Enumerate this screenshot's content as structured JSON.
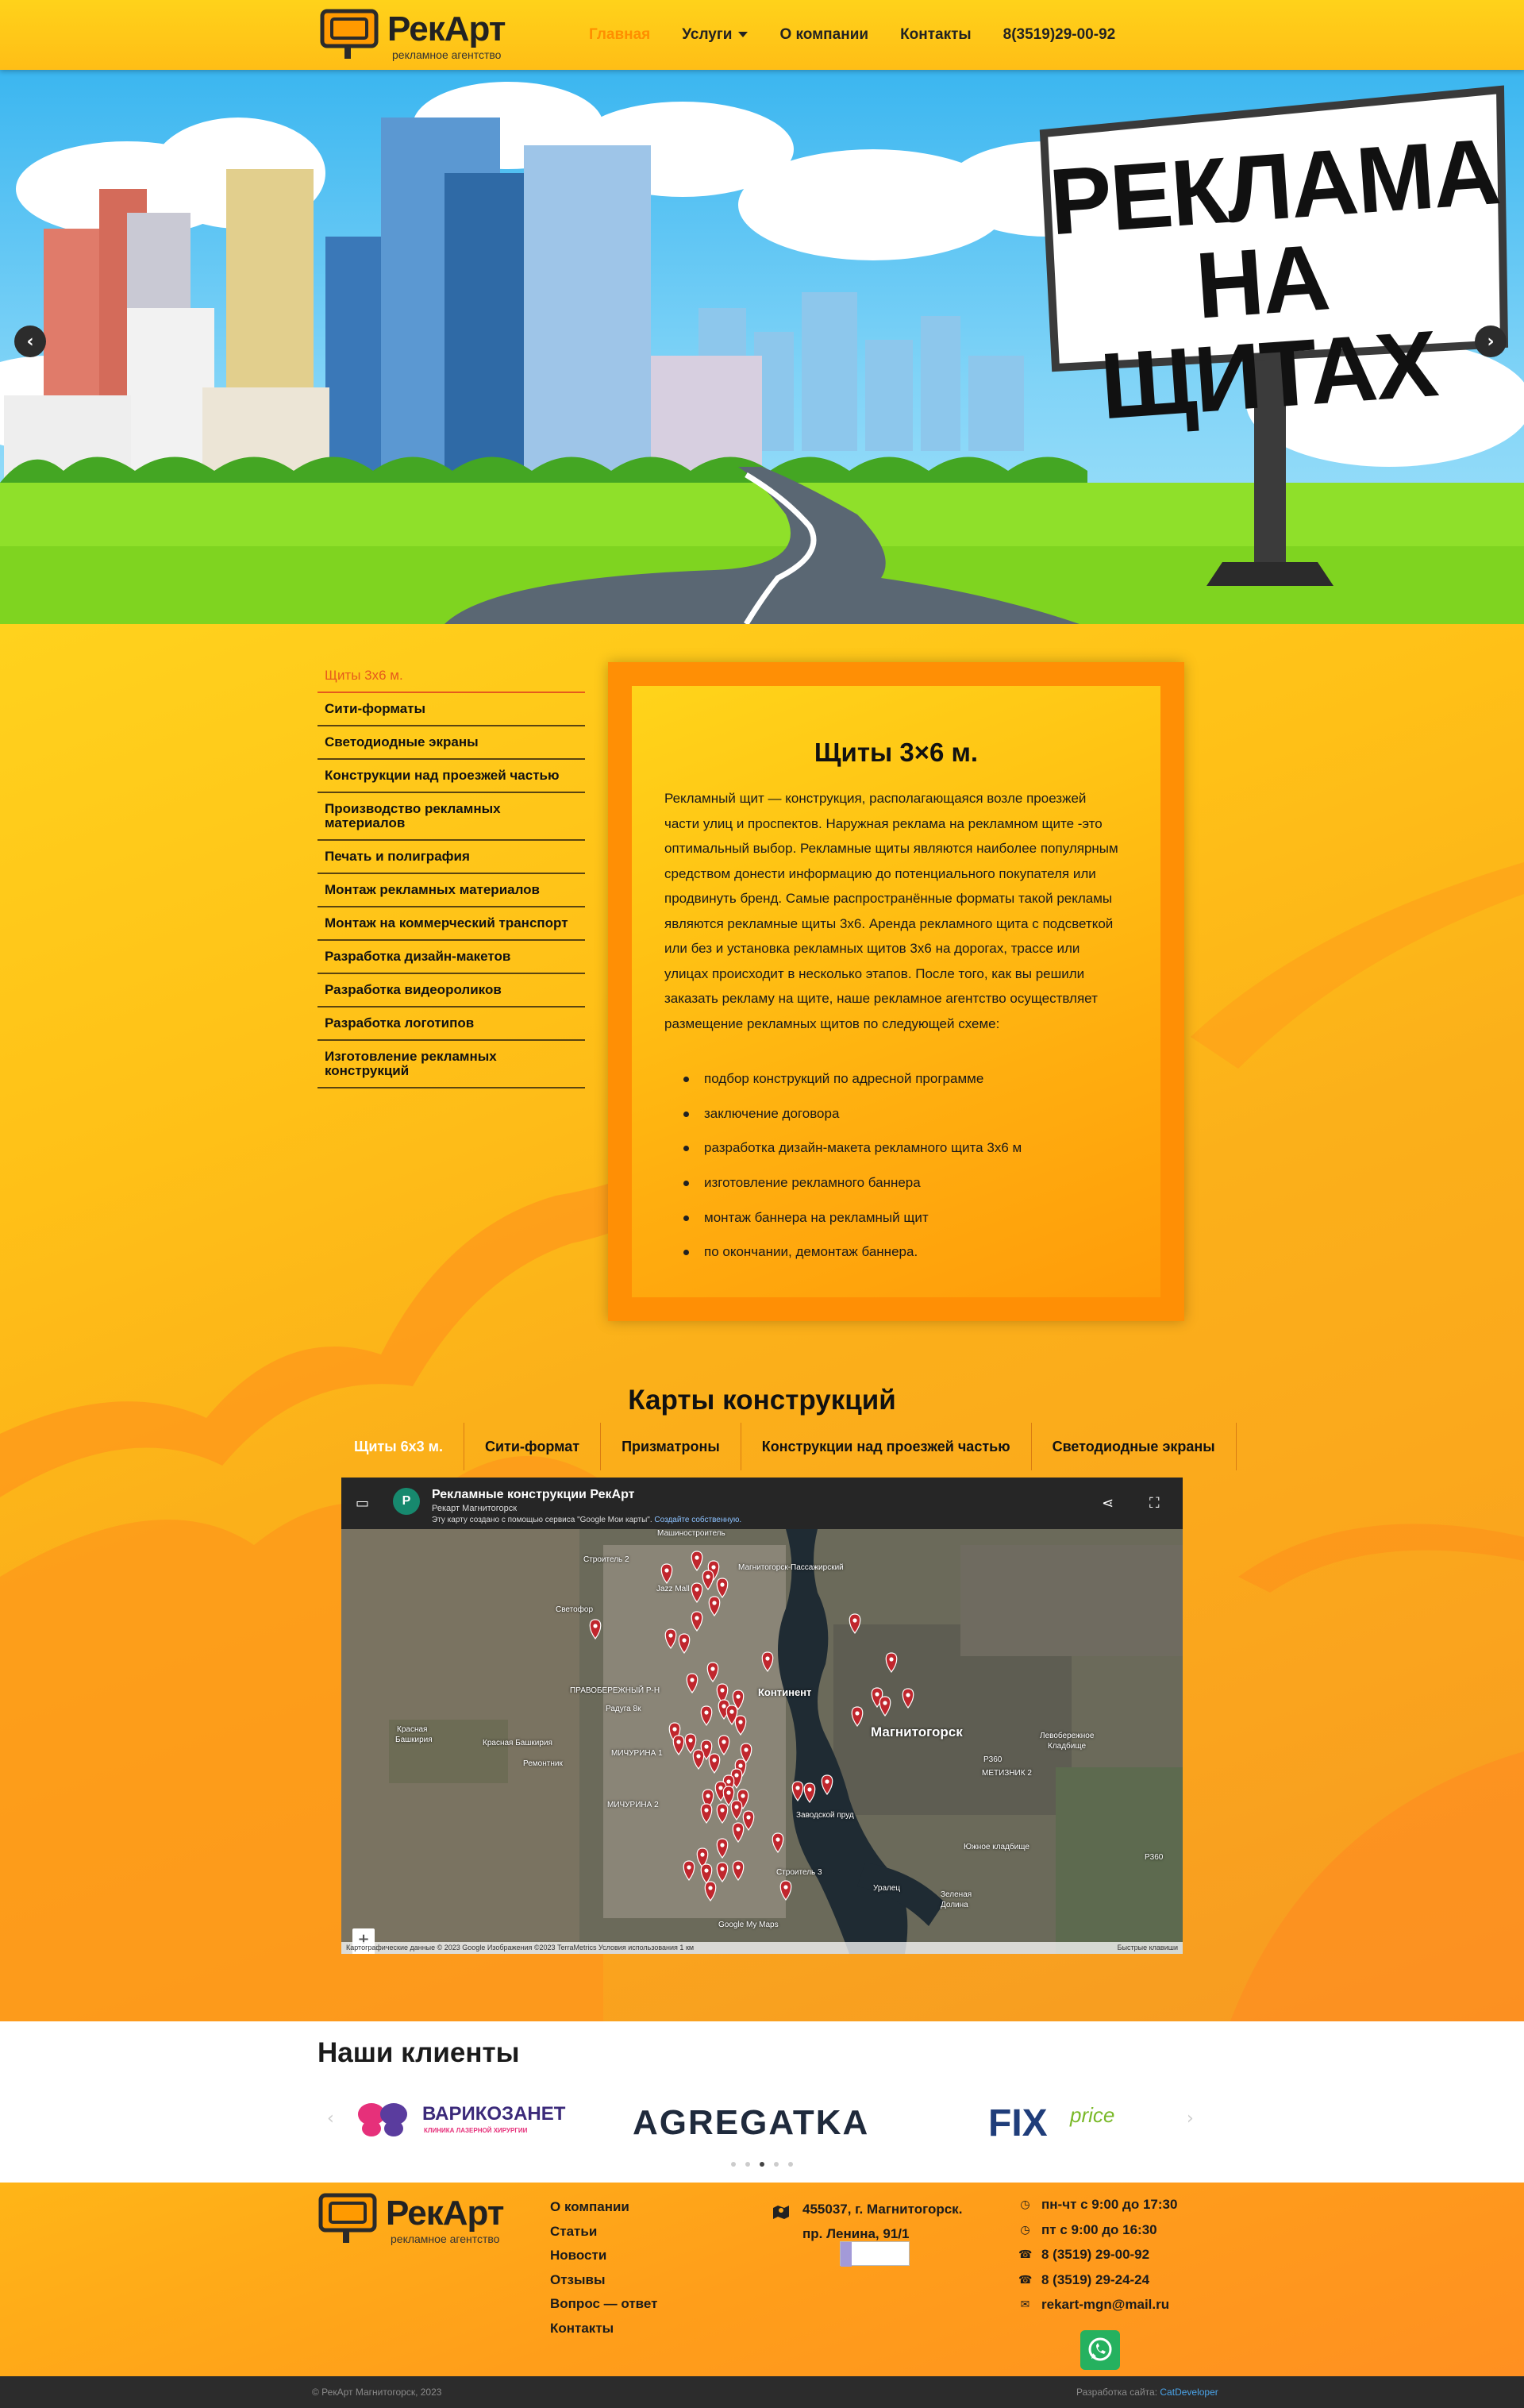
{
  "header": {
    "logo_name": "РекАрт",
    "logo_sub": "рекламное агентство",
    "nav": [
      {
        "label": "Главная",
        "active": true
      },
      {
        "label": "Услуги",
        "dropdown": true
      },
      {
        "label": "О компании"
      },
      {
        "label": "Контакты"
      },
      {
        "label": "8(3519)29-00-92"
      }
    ]
  },
  "hero": {
    "billboard_line1": "РЕКЛАМА",
    "billboard_line2": "НА ЩИТАХ",
    "prev_icon": "chevron-left-icon",
    "next_icon": "chevron-right-icon"
  },
  "sidebar": {
    "items": [
      {
        "label": "Щиты 3х6 м.",
        "active": true
      },
      {
        "label": "Сити-форматы"
      },
      {
        "label": "Светодиодные экраны"
      },
      {
        "label": "Конструкции над проезжей частью"
      },
      {
        "label": "Производство рекламных материалов"
      },
      {
        "label": "Печать и полиграфия"
      },
      {
        "label": "Монтаж рекламных материалов"
      },
      {
        "label": "Монтаж на коммерческий транспорт"
      },
      {
        "label": "Разработка дизайн-макетов"
      },
      {
        "label": "Разработка видеороликов"
      },
      {
        "label": "Разработка логотипов"
      },
      {
        "label": "Изготовление рекламных конструкций"
      }
    ]
  },
  "content": {
    "title": "Щиты 3×6 м.",
    "paragraph": "Рекламный щит — конструкция, располагающаяся возле проезжей части улиц и проспектов. Наружная реклама на рекламном щите -это оптимальный выбор.  Рекламные щиты являются наиболее популярным средством  донести информацию до потенциального покупателя или продвинуть бренд. Самые распространённые форматы такой рекламы являются рекламные щиты 3х6. Аренда рекламного щита с подсветкой или без и установка рекламных щитов 3х6 на дорогах, трассе или улицах происходит в несколько этапов. После того, как вы решили заказать рекламу на щите, наше рекламное агентство осуществляет размещение рекламных щитов по следующей схеме:",
    "steps": [
      "подбор конструкций по адресной программе",
      "заключение договора",
      "разработка дизайн-макета рекламного щита 3х6 м",
      "изготовление рекламного баннера",
      "монтаж баннера на рекламный щит",
      "по окончании, демонтаж баннера."
    ]
  },
  "maps": {
    "title": "Карты конструкций",
    "tabs": [
      {
        "label": "Щиты 6х3 м.",
        "active": true
      },
      {
        "label": "Сити-формат"
      },
      {
        "label": "Призматроны"
      },
      {
        "label": "Конструкции над проезжей частью"
      },
      {
        "label": "Светодиодные экраны"
      }
    ],
    "embed": {
      "avatar_letter": "Р",
      "title": "Рекламные конструкции РекАрт",
      "owner": "Рекарт Магнитогорск",
      "note_prefix": "Эту карту создано с помощью сервиса \"Google Мои карты\".",
      "note_link": "Создайте собственную.",
      "labels": {
        "city": "Магнитогорск",
        "kontinent": "Континент",
        "stroitel2": "Строитель 2",
        "jazz": "Jazz Mall",
        "svetofor": "Светофор",
        "mashino": "Машиностроитель",
        "passenger": "Магнитогорск-Пассажирский",
        "pravobereg": "ПРАВОБЕРЕЖНЫЙ Р-Н",
        "raduga": "Радуга 8к",
        "kb1": "Красная",
        "kb2": "Башкирия",
        "kb3": "Красная Башкирия",
        "remont": "Ремонтник",
        "michurina": "МИЧУРИНА 1",
        "michurina2": "МИЧУРИНА 2",
        "stroit3": "Строитель 3",
        "uralets": "Уралец",
        "zel1": "Зеленая",
        "zel2": "Долина",
        "levo1": "Левобережное",
        "levo2": "Кладбище",
        "south": "Южное кладбище",
        "metiznik": "МЕТИЗНИК 2",
        "zavod": "Заводской пруд",
        "p360": "Р360",
        "p360b": "Р360",
        "google": "Google My Maps"
      },
      "footer": "Картографические данные © 2023 Google Изображения ©2023 TerraMetrics     Условия использования     1 км",
      "keys": "Быстрые клавиши"
    }
  },
  "clients": {
    "title": "Наши клиенты",
    "logos": [
      {
        "name": "ВАРИКОЗАНЕТ",
        "tagline": "КЛИНИКА ЛАЗЕРНОЙ ХИРУРГИИ"
      },
      {
        "name": "AGREGATKA"
      },
      {
        "name": "FIX",
        "suffix": "price"
      }
    ]
  },
  "footer": {
    "logo_name": "РекАрт",
    "logo_sub": "рекламное агентство",
    "links": [
      "О компании",
      "Статьи",
      "Новости",
      "Отзывы",
      "Вопрос — ответ",
      "Контакты"
    ],
    "address_line1": "455037, г. Магнитогорск.",
    "address_line2": "пр. Ленина, 91/1",
    "hours1": "пн-чт с 9:00 до 17:30",
    "hours2": "пт с 9:00 до 16:30",
    "phone1": "8 (3519) 29-00-92",
    "phone2": "8 (3519) 29-24-24",
    "email": "rekart-mgn@mail.ru",
    "copyright": "© РекАрт Магнитогорск, 2023",
    "dev_label": "Разработка сайта:",
    "dev_name": "CatDeveloper"
  },
  "colors": {
    "accent": "#ff8f00",
    "active_side": "#e55b1c",
    "brand_yellow": "#ffc017",
    "whatsapp": "#25b15f"
  }
}
